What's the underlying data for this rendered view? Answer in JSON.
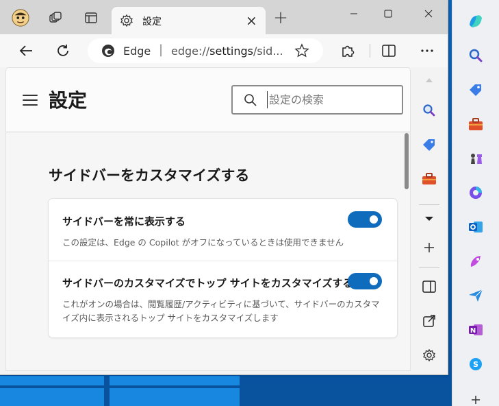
{
  "tab": {
    "title": "設定",
    "close": "×",
    "new_tab": "+"
  },
  "window_controls": {
    "minimize": "—",
    "maximize": "☐",
    "close": "✕"
  },
  "address_bar": {
    "site": "Edge",
    "separator": "|",
    "url_prefix": "edge://",
    "url_main": "settings",
    "url_suffix": "/sid..."
  },
  "settings": {
    "title": "設定",
    "search_placeholder": "設定の検索",
    "section_title": "サイドバーをカスタマイズする",
    "rows": [
      {
        "title": "サイドバーを常に表示する",
        "description": "この設定は、Edge の Copilot がオフになっているときは使用できません",
        "enabled": true
      },
      {
        "title": "サイドバーのカスタマイズでトップ サイトをカスタマイズする",
        "description": "これがオンの場合は、閲覧履歴/アクティビティに基づいて、サイドバーのカスタマイズ内に表示されるトップ サイトをカスタマイズします",
        "enabled": true
      }
    ]
  },
  "inner_sidebar_icons": [
    "search-icon",
    "tag-icon",
    "toolbox-icon",
    "caret-down-icon",
    "plus-icon",
    "sidebar-toggle-icon",
    "open-external-icon",
    "settings-gear-icon"
  ],
  "outer_sidebar_icons": [
    "copilot-icon",
    "search-icon",
    "tag-icon",
    "toolbox-icon",
    "chess-icon",
    "microsoft365-icon",
    "outlook-icon",
    "designer-icon",
    "send-icon",
    "onenote-icon",
    "skype-icon",
    "plus-icon"
  ],
  "colors": {
    "accent": "#0f6cbd",
    "titlebar": "#d5d5d5"
  }
}
